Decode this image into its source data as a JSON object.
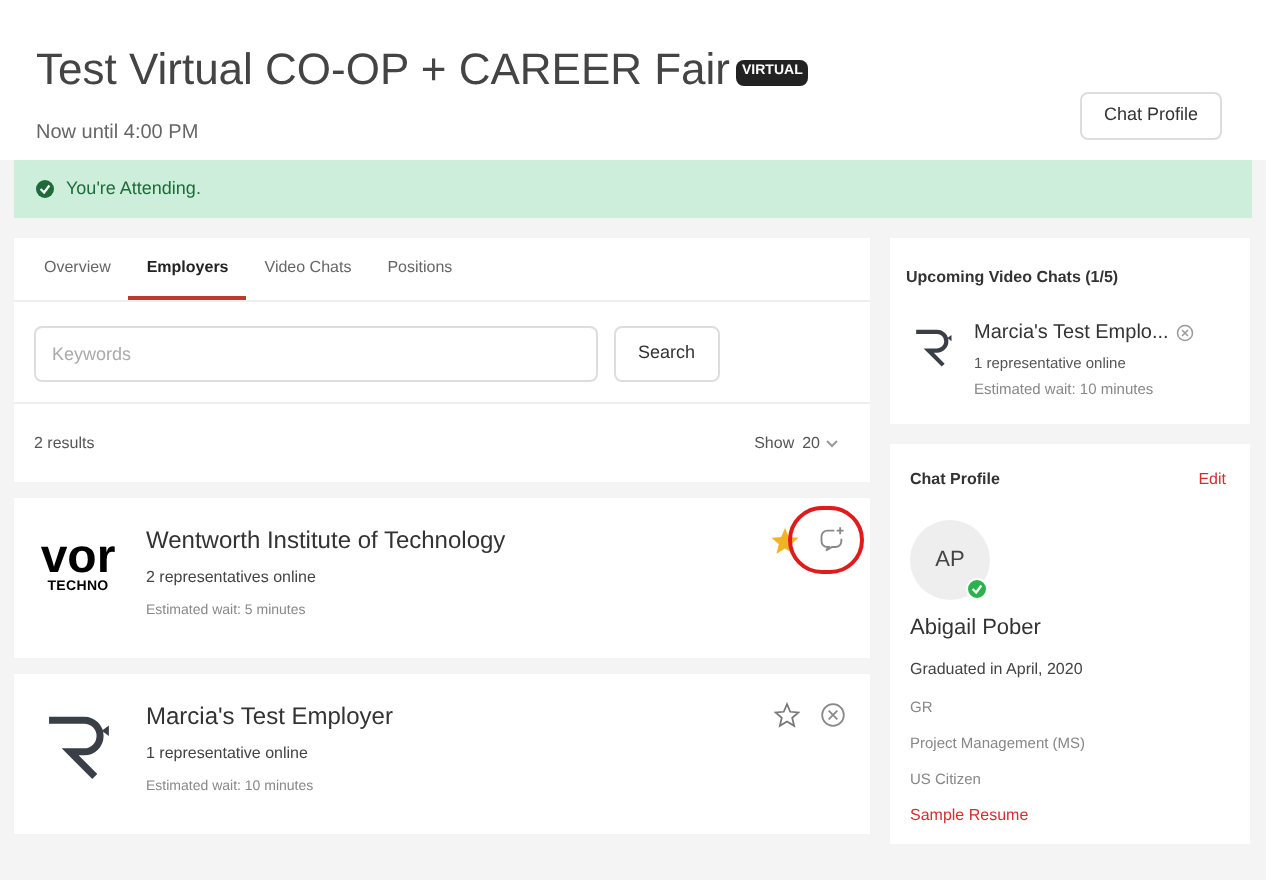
{
  "header": {
    "title": "Test Virtual CO-OP + CAREER Fair",
    "badge": "VIRTUAL",
    "subtitle": "Now until 4:00 PM",
    "button": "Chat Profile"
  },
  "banner": {
    "text": "You're Attending."
  },
  "tabs": [
    {
      "label": "Overview",
      "selected": false
    },
    {
      "label": "Employers",
      "selected": true
    },
    {
      "label": "Video Chats",
      "selected": false
    },
    {
      "label": "Positions",
      "selected": false
    }
  ],
  "search": {
    "placeholder": "Keywords",
    "button": "Search"
  },
  "results": {
    "count": "2 results",
    "show_label": "Show",
    "show_value": "20"
  },
  "employers": [
    {
      "name": "Wentworth Institute of Technology",
      "logo": {
        "kind": "wordmark",
        "text": [
          "vor",
          "TECHNO"
        ]
      },
      "reps": "2 representatives online",
      "wait": "Estimated wait: 5 minutes",
      "starred": true,
      "action": {
        "kind": "chat"
      },
      "highlighted": true
    },
    {
      "name": "Marcia's Test Employer",
      "logo": {
        "kind": "r"
      },
      "reps": "1 representative online",
      "wait": "Estimated wait: 10 minutes",
      "starred": false,
      "action": {
        "kind": "remove"
      },
      "highlighted": false
    }
  ],
  "upcoming": {
    "title": "Upcoming Video Chats (1/5)",
    "items": [
      {
        "name": "Marcia's Test Emplo...",
        "reps": "1 representative online",
        "wait": "Estimated wait: 10 minutes"
      }
    ]
  },
  "profile": {
    "title": "Chat Profile",
    "edit": "Edit",
    "initials": "AP",
    "verified": true,
    "name": "Abigail Pober",
    "graduated": "Graduated in April, 2020",
    "lines": [
      "GR",
      "Project Management (MS)",
      "US Citizen"
    ],
    "resume": "Sample Resume"
  }
}
